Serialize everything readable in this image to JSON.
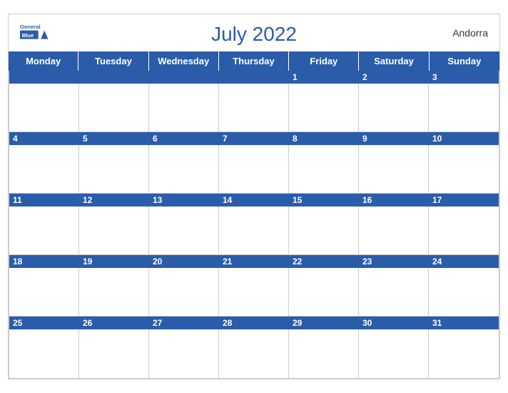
{
  "calendar": {
    "title": "July 2022",
    "country": "Andorra",
    "days": [
      "Monday",
      "Tuesday",
      "Wednesday",
      "Thursday",
      "Friday",
      "Saturday",
      "Sunday"
    ],
    "weeks": [
      {
        "numbers": [
          "",
          "",
          "",
          "",
          "1",
          "2",
          "3"
        ]
      },
      {
        "numbers": [
          "4",
          "5",
          "6",
          "7",
          "8",
          "9",
          "10"
        ]
      },
      {
        "numbers": [
          "11",
          "12",
          "13",
          "14",
          "15",
          "16",
          "17"
        ]
      },
      {
        "numbers": [
          "18",
          "19",
          "20",
          "21",
          "22",
          "23",
          "24"
        ]
      },
      {
        "numbers": [
          "25",
          "26",
          "27",
          "28",
          "29",
          "30",
          "31"
        ]
      }
    ]
  },
  "logo": {
    "text_general": "General",
    "text_blue": "Blue"
  }
}
